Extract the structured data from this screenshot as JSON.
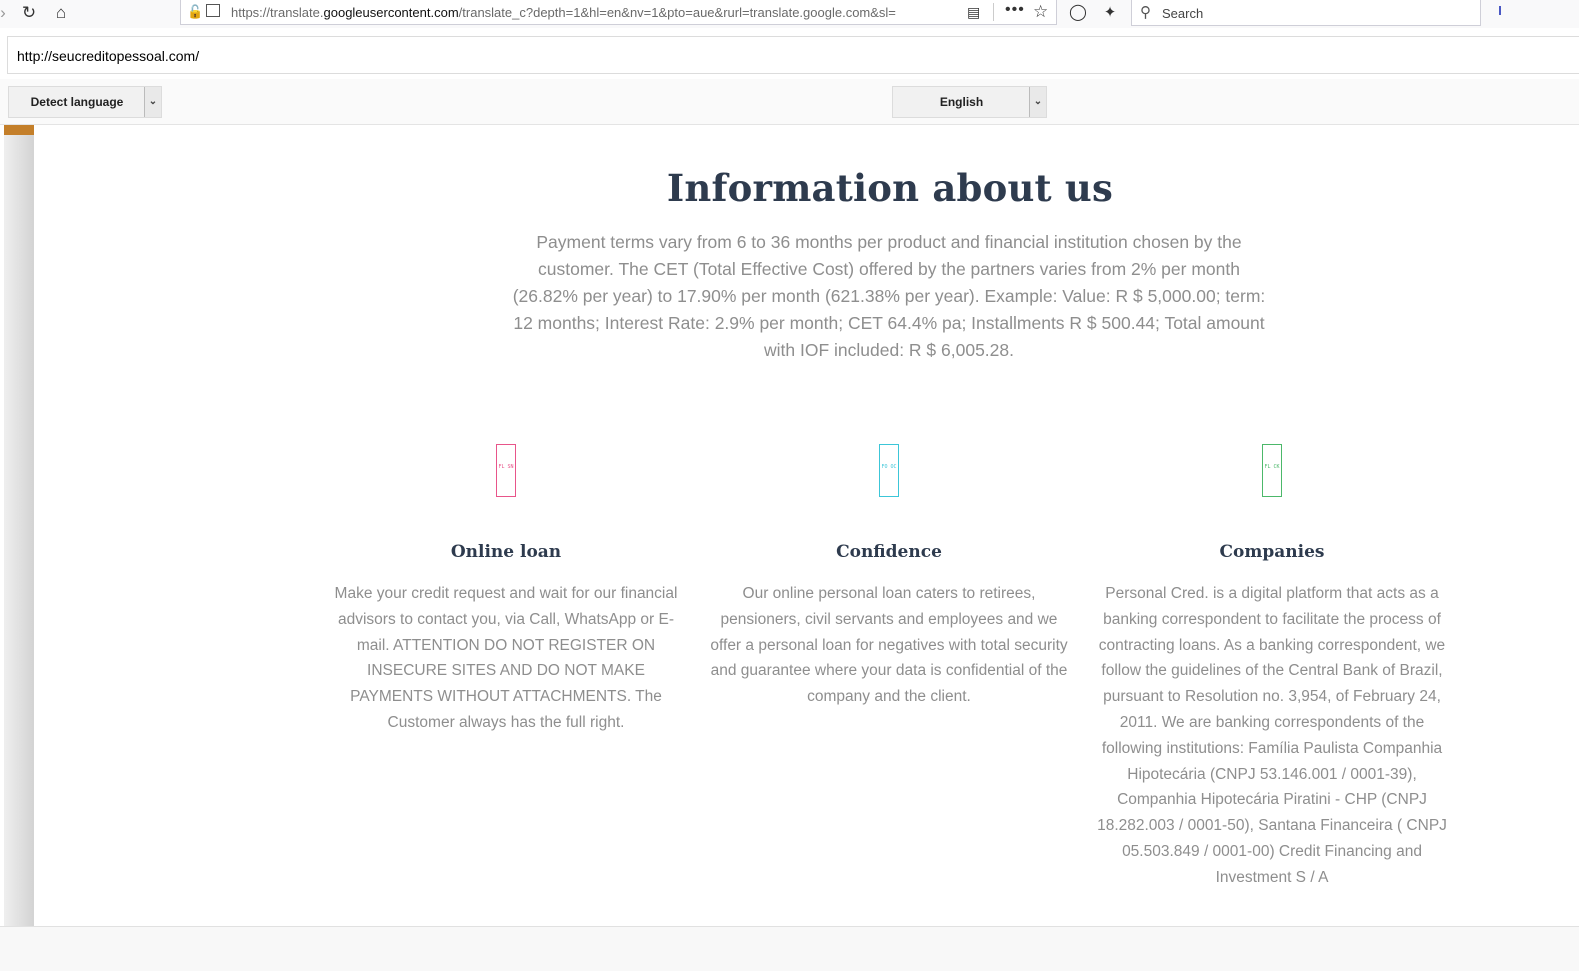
{
  "browser": {
    "url_prefix": "https://translate.",
    "url_domain": "googleusercontent.com",
    "url_rest": "/translate_c?depth=1&hl=en&nv=1&pto=aue&rurl=translate.google.com&sl=",
    "search_placeholder": "Search"
  },
  "translate": {
    "source_url": "http://seucreditopessoal.com/",
    "source_language": "Detect language",
    "target_language": "English"
  },
  "page": {
    "title": "Information about us",
    "intro": "Payment terms vary from 6 to 36 months per product and financial institution chosen by the customer. The CET (Total Effective Cost) offered by the partners varies from 2% per month (26.82% per year) to 17.90% per month (621.38% per year). Example: Value: R $ 5,000.00; term: 12 months; Interest Rate: 2.9% per month; CET 64.4% pa; Installments R $ 500.44; Total amount with IOF included: R $ 6,005.28.",
    "features": [
      {
        "heading": "Online loan",
        "badge_text": "FL SN",
        "color": "#e8558a",
        "text": "Make your credit request and wait for our financial advisors to contact you, via Call, WhatsApp or E-mail. ATTENTION DO NOT REGISTER ON INSECURE SITES AND DO NOT MAKE PAYMENTS WITHOUT ATTACHMENTS. The Customer always has the full right."
      },
      {
        "heading": "Confidence",
        "badge_text": "FO OC",
        "color": "#3cc6d8",
        "text": "Our online personal loan caters to retirees, pensioners, civil servants and employees and we offer a personal loan for negatives with total security and guarantee where your data is confidential of the company and the client."
      },
      {
        "heading": "Companies",
        "badge_text": "FL CK",
        "color": "#4cb86a",
        "text": "Personal Cred. is a digital platform that acts as a banking correspondent to facilitate the process of contracting loans. As a banking correspondent, we follow the guidelines of the Central Bank of Brazil, pursuant to Resolution no. 3,954, of February 24, 2011. We are banking correspondents of the following institutions: Família Paulista Companhia Hipotecária (CNPJ 53.146.001 / 0001-39), Companhia Hipotecária Piratini - CHP (CNPJ 18.282.003 / 0001-50), Santana Financeira ( CNPJ 05.503.849 / 0001-00) Credit Financing and Investment S / A"
      }
    ]
  }
}
